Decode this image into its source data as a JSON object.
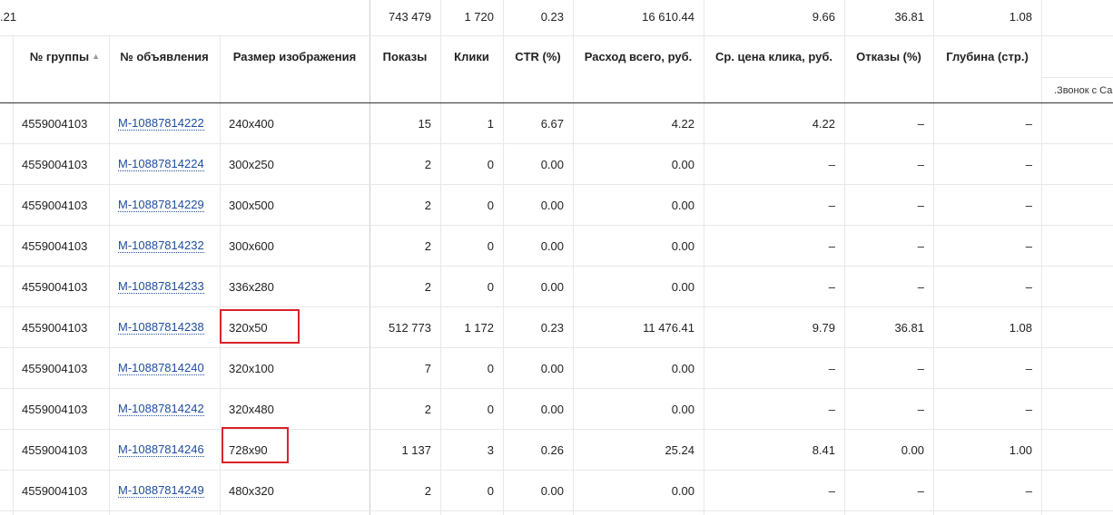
{
  "summary": {
    "partial": ".21",
    "impressions": "743 479",
    "clicks": "1 720",
    "ctr": "0.23",
    "spend": "16 610.44",
    "avg_cpc": "9.66",
    "bounces": "36.81",
    "depth": "1.08"
  },
  "headers": {
    "group": "№ группы",
    "ad": "№ объявления",
    "size": "Размер изображения",
    "impressions": "Показы",
    "clicks": "Клики",
    "ctr": "CTR (%)",
    "spend": "Расход всего, руб.",
    "avg_cpc": "Ср. цена клика, руб.",
    "bounces": "Отказы (%)",
    "depth": "Глубина (стр.)",
    "extra": ".Звонок с Са"
  },
  "sort_icon": "sort-ascending-icon",
  "highlight_color": "#d9232a",
  "rows": [
    {
      "group": "4559004103",
      "ad": "M-10887814222",
      "size": "240x400",
      "impressions": "15",
      "clicks": "1",
      "ctr": "6.67",
      "spend": "4.22",
      "avg_cpc": "4.22",
      "bounces": "–",
      "depth": "–"
    },
    {
      "group": "4559004103",
      "ad": "M-10887814224",
      "size": "300x250",
      "impressions": "2",
      "clicks": "0",
      "ctr": "0.00",
      "spend": "0.00",
      "avg_cpc": "–",
      "bounces": "–",
      "depth": "–"
    },
    {
      "group": "4559004103",
      "ad": "M-10887814229",
      "size": "300x500",
      "impressions": "2",
      "clicks": "0",
      "ctr": "0.00",
      "spend": "0.00",
      "avg_cpc": "–",
      "bounces": "–",
      "depth": "–"
    },
    {
      "group": "4559004103",
      "ad": "M-10887814232",
      "size": "300x600",
      "impressions": "2",
      "clicks": "0",
      "ctr": "0.00",
      "spend": "0.00",
      "avg_cpc": "–",
      "bounces": "–",
      "depth": "–"
    },
    {
      "group": "4559004103",
      "ad": "M-10887814233",
      "size": "336x280",
      "impressions": "2",
      "clicks": "0",
      "ctr": "0.00",
      "spend": "0.00",
      "avg_cpc": "–",
      "bounces": "–",
      "depth": "–"
    },
    {
      "group": "4559004103",
      "ad": "M-10887814238",
      "size": "320x50",
      "impressions": "512 773",
      "clicks": "1 172",
      "ctr": "0.23",
      "spend": "11 476.41",
      "avg_cpc": "9.79",
      "bounces": "36.81",
      "depth": "1.08"
    },
    {
      "group": "4559004103",
      "ad": "M-10887814240",
      "size": "320x100",
      "impressions": "7",
      "clicks": "0",
      "ctr": "0.00",
      "spend": "0.00",
      "avg_cpc": "–",
      "bounces": "–",
      "depth": "–"
    },
    {
      "group": "4559004103",
      "ad": "M-10887814242",
      "size": "320x480",
      "impressions": "2",
      "clicks": "0",
      "ctr": "0.00",
      "spend": "0.00",
      "avg_cpc": "–",
      "bounces": "–",
      "depth": "–"
    },
    {
      "group": "4559004103",
      "ad": "M-10887814246",
      "size": "728x90",
      "impressions": "1 137",
      "clicks": "3",
      "ctr": "0.26",
      "spend": "25.24",
      "avg_cpc": "8.41",
      "bounces": "0.00",
      "depth": "1.00"
    },
    {
      "group": "4559004103",
      "ad": "M-10887814249",
      "size": "480x320",
      "impressions": "2",
      "clicks": "0",
      "ctr": "0.00",
      "spend": "0.00",
      "avg_cpc": "–",
      "bounces": "–",
      "depth": "–"
    }
  ]
}
